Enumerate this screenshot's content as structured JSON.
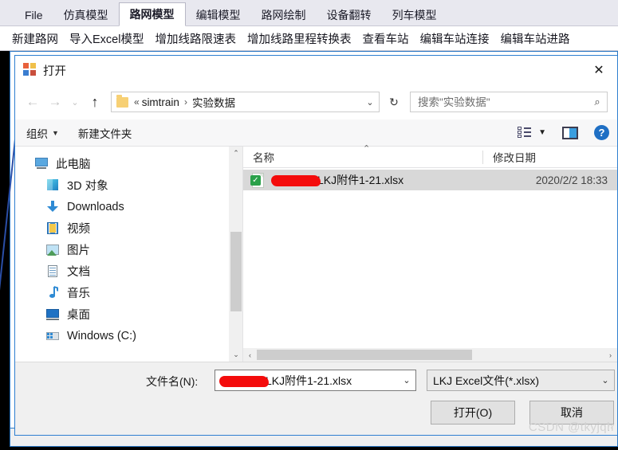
{
  "app": {
    "tabs": [
      {
        "label": "File",
        "active": false
      },
      {
        "label": "仿真模型",
        "active": false
      },
      {
        "label": "路网模型",
        "active": true
      },
      {
        "label": "编辑模型",
        "active": false
      },
      {
        "label": "路网绘制",
        "active": false
      },
      {
        "label": "设备翻转",
        "active": false
      },
      {
        "label": "列车模型",
        "active": false
      }
    ],
    "commands": [
      "新建路网",
      "导入Excel模型",
      "增加线路限速表",
      "增加线路里程转换表",
      "查看车站",
      "编辑车站连接",
      "编辑车站进路"
    ]
  },
  "dialog": {
    "title": "打开",
    "close_label": "✕",
    "nav": {
      "back": "←",
      "forward": "→",
      "recent": "⌄",
      "up": "↑",
      "refresh": "↻"
    },
    "address": {
      "chevrons": "«",
      "crumb1": "simtrain",
      "separator": "›",
      "crumb2": "实验数据",
      "dropdown_caret": "⌄"
    },
    "search": {
      "placeholder": "搜索\"实验数据\"",
      "icon": "⌕"
    },
    "commandbar": {
      "organize": "组织",
      "organize_caret": "▼",
      "new_folder": "新建文件夹",
      "view_caret": "▼",
      "help": "?"
    },
    "sidebar": {
      "items": [
        {
          "label": "此电脑",
          "icon": "this-pc-icon",
          "child": false
        },
        {
          "label": "3D 对象",
          "icon": "3d-objects-icon",
          "child": true
        },
        {
          "label": "Downloads",
          "icon": "downloads-icon",
          "child": true
        },
        {
          "label": "视频",
          "icon": "videos-icon",
          "child": true
        },
        {
          "label": "图片",
          "icon": "pictures-icon",
          "child": true
        },
        {
          "label": "文档",
          "icon": "documents-icon",
          "child": true
        },
        {
          "label": "音乐",
          "icon": "music-icon",
          "child": true
        },
        {
          "label": "桌面",
          "icon": "desktop-icon",
          "child": true
        },
        {
          "label": "Windows (C:)",
          "icon": "drive-icon",
          "child": true
        }
      ],
      "scroll_up": "⌃",
      "scroll_down": "⌄"
    },
    "filelist": {
      "columns": {
        "name": "名称",
        "date_modified": "修改日期",
        "sort_indicator": "⌃"
      },
      "rows": [
        {
          "name": "LKJ附件1-21.xlsx",
          "date_modified": "2020/2/2 18:33",
          "redacted": true,
          "selected": true,
          "icon": "excel-file-icon",
          "sync_badge": "✓"
        }
      ],
      "hscroll_left": "‹",
      "hscroll_right": "›"
    },
    "footer": {
      "filename_label": "文件名(N):",
      "filename_value": "LKJ附件1-21.xlsx",
      "filename_redacted": true,
      "filetype_value": "LKJ Excel文件(*.xlsx)",
      "combo_caret": "⌄",
      "open_button": "打开(O)",
      "cancel_button": "取消"
    }
  },
  "watermark": {
    "text": "CSDN @tkyjqh",
    "dots": "⋰"
  },
  "colors": {
    "accent_blue": "#2f7fd0",
    "selection_grey": "#d8d8d8",
    "redaction_red": "#f40c0c",
    "sync_green": "#2aa14a",
    "help_blue": "#1f6fc4"
  }
}
